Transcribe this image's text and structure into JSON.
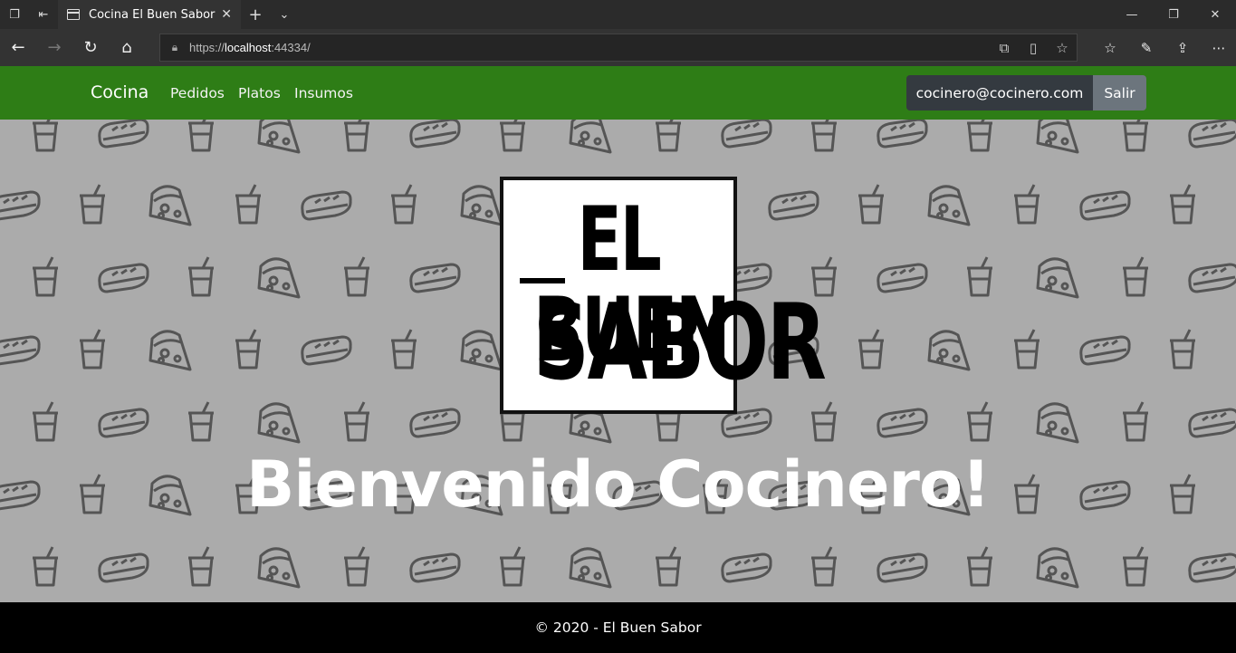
{
  "browser": {
    "tab_title": "Cocina El Buen Sabor",
    "url_prefix": "https://",
    "url_host": "localhost",
    "url_rest": ":44334/"
  },
  "site": {
    "brand": "Cocina",
    "nav": [
      "Pedidos",
      "Platos",
      "Insumos"
    ],
    "user_email": "cocinero@cocinero.com",
    "logout_label": "Salir"
  },
  "hero": {
    "logo_line1": "EL BUEN",
    "logo_line2": "SABOR",
    "welcome": "Bienvenido Cocinero!"
  },
  "footer": {
    "text": "© 2020 - El Buen Sabor"
  },
  "colors": {
    "navbar": "#2e7d16",
    "hero_bg": "#ababab",
    "pattern_icon": "#555555"
  }
}
